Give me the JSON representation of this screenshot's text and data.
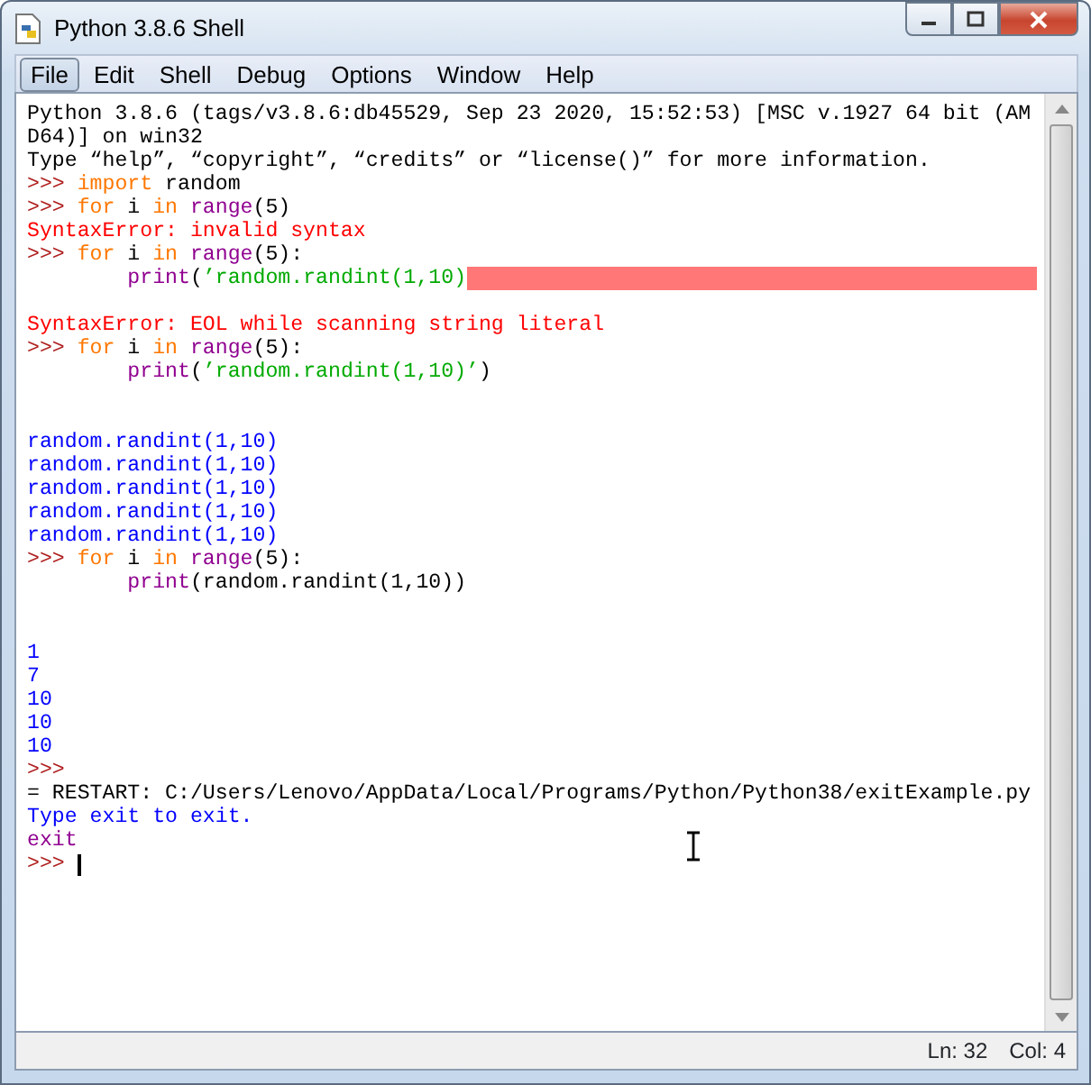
{
  "window": {
    "title": "Python 3.8.6 Shell"
  },
  "menu": [
    {
      "label": "File",
      "selected": true
    },
    {
      "label": "Edit",
      "selected": false
    },
    {
      "label": "Shell",
      "selected": false
    },
    {
      "label": "Debug",
      "selected": false
    },
    {
      "label": "Options",
      "selected": false
    },
    {
      "label": "Window",
      "selected": false
    },
    {
      "label": "Help",
      "selected": false
    }
  ],
  "shell_lines": [
    {
      "segments": [
        {
          "kind": "plain",
          "text": "Python 3.8.6 (tags/v3.8.6:db45529, Sep 23 2020, 15:52:53) [MSC v.1927 64 bit (AM"
        }
      ]
    },
    {
      "segments": [
        {
          "kind": "plain",
          "text": "D64)] on win32"
        }
      ]
    },
    {
      "segments": [
        {
          "kind": "plain",
          "text": "Type “help”, “copyright”, “credits” or “license()” for more information."
        }
      ]
    },
    {
      "segments": [
        {
          "kind": "prompt",
          "text": ">>> "
        },
        {
          "kind": "keyword",
          "text": "import"
        },
        {
          "kind": "plain",
          "text": " random"
        }
      ]
    },
    {
      "segments": [
        {
          "kind": "prompt",
          "text": ">>> "
        },
        {
          "kind": "keyword",
          "text": "for"
        },
        {
          "kind": "plain",
          "text": " i "
        },
        {
          "kind": "keyword",
          "text": "in "
        },
        {
          "kind": "builtin",
          "text": "range"
        },
        {
          "kind": "plain",
          "text": "(5)"
        }
      ]
    },
    {
      "segments": [
        {
          "kind": "error",
          "text": "SyntaxError: invalid syntax"
        }
      ]
    },
    {
      "segments": [
        {
          "kind": "prompt",
          "text": ">>> "
        },
        {
          "kind": "keyword",
          "text": "for"
        },
        {
          "kind": "plain",
          "text": " i "
        },
        {
          "kind": "keyword",
          "text": "in "
        },
        {
          "kind": "builtin",
          "text": "range"
        },
        {
          "kind": "plain",
          "text": "(5):"
        }
      ]
    },
    {
      "indented": true,
      "segments": [
        {
          "kind": "builtin",
          "text": "print"
        },
        {
          "kind": "plain",
          "text": "("
        },
        {
          "kind": "string",
          "text": "’random.randint(1,10)"
        },
        {
          "kind": "error_mark"
        }
      ]
    },
    {
      "kind": "blank"
    },
    {
      "segments": [
        {
          "kind": "error",
          "text": "SyntaxError: EOL while scanning string literal"
        }
      ]
    },
    {
      "segments": [
        {
          "kind": "prompt",
          "text": ">>> "
        },
        {
          "kind": "keyword",
          "text": "for"
        },
        {
          "kind": "plain",
          "text": " i "
        },
        {
          "kind": "keyword",
          "text": "in "
        },
        {
          "kind": "builtin",
          "text": "range"
        },
        {
          "kind": "plain",
          "text": "(5):"
        }
      ]
    },
    {
      "indented": true,
      "segments": [
        {
          "kind": "builtin",
          "text": "print"
        },
        {
          "kind": "plain",
          "text": "("
        },
        {
          "kind": "string",
          "text": "’random.randint(1,10)’"
        },
        {
          "kind": "plain",
          "text": ")"
        }
      ]
    },
    {
      "kind": "blank"
    },
    {
      "kind": "blank"
    },
    {
      "segments": [
        {
          "kind": "output",
          "text": "random.randint(1,10)"
        }
      ]
    },
    {
      "segments": [
        {
          "kind": "output",
          "text": "random.randint(1,10)"
        }
      ]
    },
    {
      "segments": [
        {
          "kind": "output",
          "text": "random.randint(1,10)"
        }
      ]
    },
    {
      "segments": [
        {
          "kind": "output",
          "text": "random.randint(1,10)"
        }
      ]
    },
    {
      "segments": [
        {
          "kind": "output",
          "text": "random.randint(1,10)"
        }
      ]
    },
    {
      "segments": [
        {
          "kind": "prompt",
          "text": ">>> "
        },
        {
          "kind": "keyword",
          "text": "for"
        },
        {
          "kind": "plain",
          "text": " i "
        },
        {
          "kind": "keyword",
          "text": "in "
        },
        {
          "kind": "builtin",
          "text": "range"
        },
        {
          "kind": "plain",
          "text": "(5):"
        }
      ]
    },
    {
      "indented": true,
      "segments": [
        {
          "kind": "builtin",
          "text": "print"
        },
        {
          "kind": "plain",
          "text": "(random.randint(1,10))"
        }
      ]
    },
    {
      "kind": "blank"
    },
    {
      "kind": "blank"
    },
    {
      "segments": [
        {
          "kind": "output",
          "text": "1"
        }
      ]
    },
    {
      "segments": [
        {
          "kind": "output",
          "text": "7"
        }
      ]
    },
    {
      "segments": [
        {
          "kind": "output",
          "text": "10"
        }
      ]
    },
    {
      "segments": [
        {
          "kind": "output",
          "text": "10"
        }
      ]
    },
    {
      "segments": [
        {
          "kind": "output",
          "text": "10"
        }
      ]
    },
    {
      "segments": [
        {
          "kind": "prompt",
          "text": ">>> "
        }
      ]
    },
    {
      "segments": [
        {
          "kind": "plain",
          "text": "= RESTART: C:/Users/Lenovo/AppData/Local/Programs/Python/Python38/exitExample.py"
        }
      ]
    },
    {
      "segments": [
        {
          "kind": "output",
          "text": "Type exit to exit."
        }
      ]
    },
    {
      "segments": [
        {
          "kind": "builtin",
          "text": "exit"
        }
      ]
    },
    {
      "segments": [
        {
          "kind": "prompt",
          "text": ">>> "
        },
        {
          "kind": "cursor"
        }
      ]
    }
  ],
  "status_bar": {
    "line": "Ln: 32",
    "column": "Col: 4"
  }
}
